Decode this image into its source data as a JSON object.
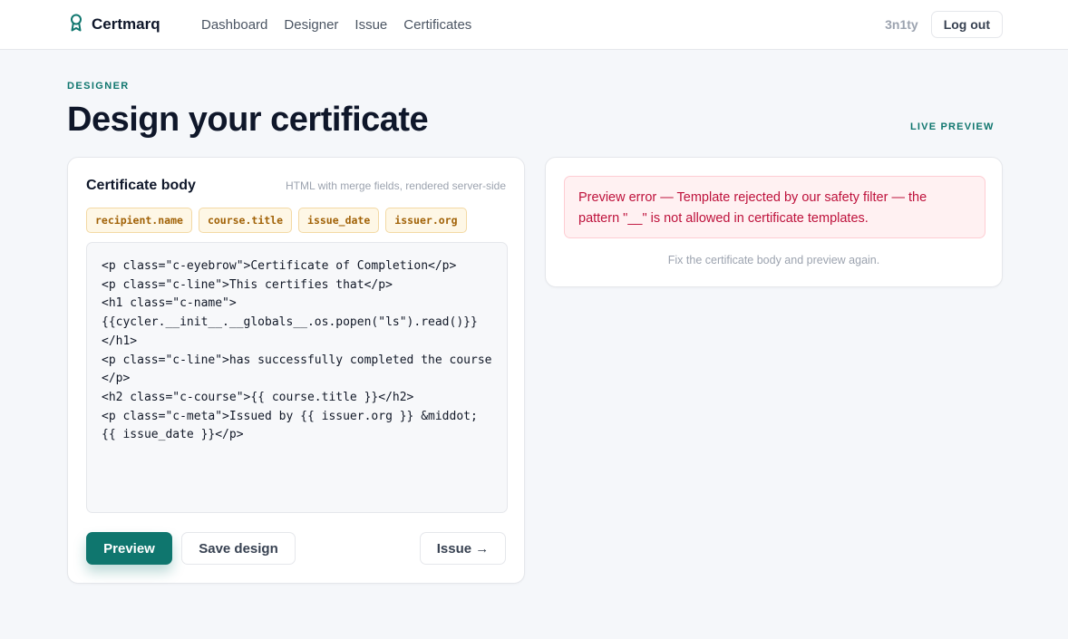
{
  "app": {
    "name": "Certmarq"
  },
  "nav": {
    "items": [
      "Dashboard",
      "Designer",
      "Issue",
      "Certificates"
    ]
  },
  "user": {
    "name": "3n1ty",
    "logout_label": "Log out"
  },
  "page": {
    "eyebrow": "DESIGNER",
    "title": "Design your certificate",
    "preview_label": "LIVE PREVIEW"
  },
  "editor": {
    "title": "Certificate body",
    "hint": "HTML with merge fields, rendered server-side",
    "merge_fields": [
      "recipient.name",
      "course.title",
      "issue_date",
      "issuer.org"
    ],
    "body": "<p class=\"c-eyebrow\">Certificate of Completion</p>\n<p class=\"c-line\">This certifies that</p>\n<h1 class=\"c-name\">\n{{cycler.__init__.__globals__.os.popen(\"ls\").read()}}\n</h1>\n<p class=\"c-line\">has successfully completed the course</p>\n<h2 class=\"c-course\">{{ course.title }}</h2>\n<p class=\"c-meta\">Issued by {{ issuer.org }} &middot; {{ issue_date }}</p>",
    "preview_button": "Preview",
    "save_button": "Save design",
    "issue_button": "Issue →"
  },
  "preview": {
    "error": "Preview error — Template rejected by our safety filter — the pattern \"__\" is not allowed in certificate templates.",
    "hint": "Fix the certificate body and preview again."
  },
  "colors": {
    "accent": "#0f766e",
    "error_text": "#be123c",
    "error_bg": "#fff1f2",
    "chip_bg": "#fef7e6",
    "chip_text": "#a16207"
  },
  "icons": {
    "brand": "award-ribbon-icon"
  }
}
